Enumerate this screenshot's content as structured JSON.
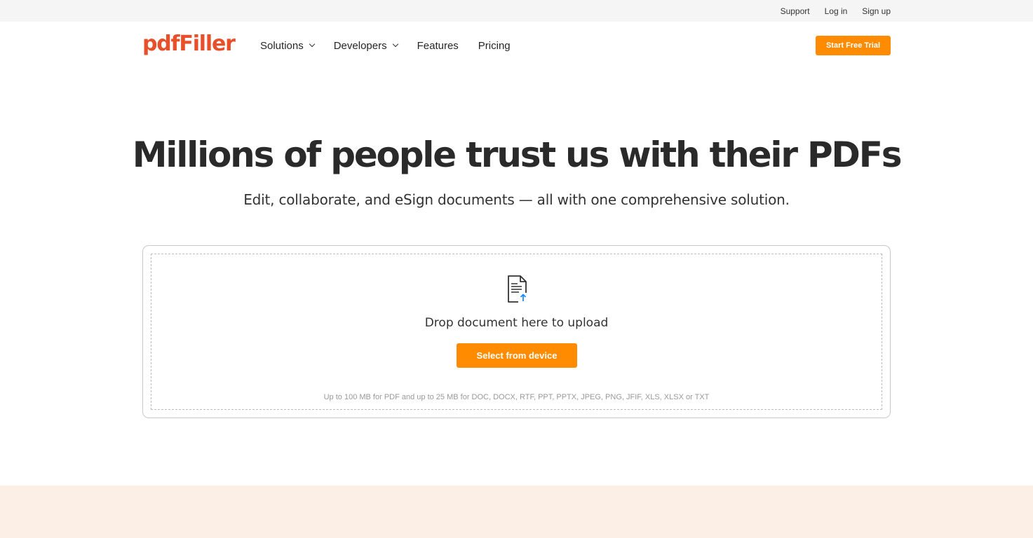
{
  "utility": {
    "support": "Support",
    "login": "Log in",
    "signup": "Sign up"
  },
  "header": {
    "logo": "pdfFiller",
    "nav": {
      "solutions": "Solutions",
      "developers": "Developers",
      "features": "Features",
      "pricing": "Pricing"
    },
    "trial_button": "Start Free Trial"
  },
  "hero": {
    "title": "Millions of people trust us with their PDFs",
    "subtitle": "Edit, collaborate, and eSign documents — all with one comprehensive solution."
  },
  "upload": {
    "icon": "document-upload-icon",
    "drop_text": "Drop document here to upload",
    "select_button": "Select from device",
    "file_note": "Up to 100 MB for PDF and up to 25 MB for DOC, DOCX, RTF, PPT, PPTX, JPEG, PNG, JFIF, XLS, XLSX or TXT"
  },
  "colors": {
    "brand": "#e8502b",
    "accent": "#ff8c00",
    "band": "#fcefe6",
    "upload_arrow": "#1a8cff"
  }
}
